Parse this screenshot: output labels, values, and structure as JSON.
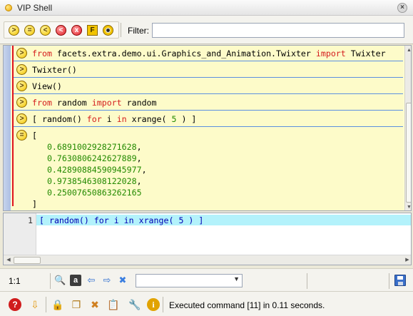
{
  "window": {
    "title": "VIP Shell"
  },
  "toolbar": {
    "buttons": [
      {
        "name": "show-commands-button",
        "glyph": ">",
        "style": "yel"
      },
      {
        "name": "show-results-button",
        "glyph": "=",
        "style": "yel"
      },
      {
        "name": "show-output-button",
        "glyph": "<",
        "style": "yel"
      },
      {
        "name": "show-errors-button",
        "glyph": "<",
        "style": "red"
      },
      {
        "name": "clear-button",
        "glyph": "x",
        "style": "red"
      },
      {
        "name": "show-files-button",
        "glyph": "F",
        "style": "sq"
      },
      {
        "name": "show-views-button",
        "glyph": "",
        "style": "eye"
      }
    ],
    "filter_label": "Filter:",
    "filter_value": ""
  },
  "history": {
    "entries": [
      {
        "kind": "command",
        "glyph": ">",
        "code": [
          [
            "kw",
            "from"
          ],
          [
            "t",
            " facets.extra.demo.ui.Graphics_and_Animation.Twixter "
          ],
          [
            "kw",
            "import"
          ],
          [
            "t",
            " Twixter"
          ]
        ]
      },
      {
        "kind": "command",
        "glyph": ">",
        "code": [
          [
            "t",
            "Twixter()"
          ]
        ]
      },
      {
        "kind": "command",
        "glyph": ">",
        "code": [
          [
            "t",
            "View()"
          ]
        ]
      },
      {
        "kind": "command",
        "glyph": ">",
        "code": [
          [
            "kw",
            "from"
          ],
          [
            "t",
            " random "
          ],
          [
            "kw",
            "import"
          ],
          [
            "t",
            " random"
          ]
        ]
      },
      {
        "kind": "command",
        "glyph": ">",
        "code": [
          [
            "t",
            "[ random() "
          ],
          [
            "kw",
            "for"
          ],
          [
            "t",
            " i "
          ],
          [
            "kw",
            "in"
          ],
          [
            "t",
            " xrange( "
          ],
          [
            "num",
            "5"
          ],
          [
            "t",
            " ) ]"
          ]
        ]
      },
      {
        "kind": "result",
        "glyph": "=",
        "lines": [
          [
            [
              "t",
              "["
            ]
          ],
          [
            [
              "t",
              "   "
            ],
            [
              "val",
              "0.6891002928271628"
            ],
            [
              "t",
              ","
            ]
          ],
          [
            [
              "t",
              "   "
            ],
            [
              "val",
              "0.7630806242627889"
            ],
            [
              "t",
              ","
            ]
          ],
          [
            [
              "t",
              "   "
            ],
            [
              "val",
              "0.42890884590945977"
            ],
            [
              "t",
              ","
            ]
          ],
          [
            [
              "t",
              "   "
            ],
            [
              "val",
              "0.9738546308122028"
            ],
            [
              "t",
              ","
            ]
          ],
          [
            [
              "t",
              "   "
            ],
            [
              "val",
              "0.25007650863262165"
            ]
          ],
          [
            [
              "t",
              "]"
            ]
          ]
        ]
      }
    ]
  },
  "editor": {
    "line_number": "1",
    "code": [
      [
        "t",
        "[ random() for i in xrange( 5 ) ]"
      ]
    ]
  },
  "statusbar": {
    "position": "1:1",
    "icons": [
      {
        "name": "zoom-icon",
        "glyph": "🔍",
        "interactable": true
      },
      {
        "name": "font-icon",
        "glyph": "a",
        "interactable": true
      },
      {
        "name": "back-arrow-icon",
        "glyph": "⇦",
        "interactable": true
      },
      {
        "name": "forward-arrow-icon",
        "glyph": "⇨",
        "interactable": true
      },
      {
        "name": "cancel-icon",
        "glyph": "✖",
        "interactable": true
      }
    ],
    "combo_value": ""
  },
  "bottombar": {
    "icons": [
      {
        "name": "help-icon",
        "glyph": "?",
        "color": "#d01c1c"
      },
      {
        "name": "down-arrow-icon",
        "glyph": "⇩",
        "color": "#e29a14"
      },
      {
        "name": "lock-icon",
        "glyph": "🔒",
        "color": "#999999"
      },
      {
        "name": "copy-icon",
        "glyph": "❐",
        "color": "#b07a1a"
      },
      {
        "name": "delete-icon",
        "glyph": "✖",
        "color": "#d08020"
      },
      {
        "name": "paste-icon",
        "glyph": "📋",
        "color": "#7a7a7a"
      },
      {
        "name": "tools-icon",
        "glyph": "🔧",
        "color": "#6d6d6d"
      },
      {
        "name": "info-icon",
        "glyph": "i",
        "color": "#e1a300"
      }
    ],
    "status_message": "Executed command [11] in 0.11 seconds."
  },
  "colors": {
    "history_background": "#fdfbc9",
    "separator_line": "#5b8edd",
    "keyword": "#d41c1c",
    "number": "#238a00",
    "editor_highlight": "#b3f2fb"
  }
}
